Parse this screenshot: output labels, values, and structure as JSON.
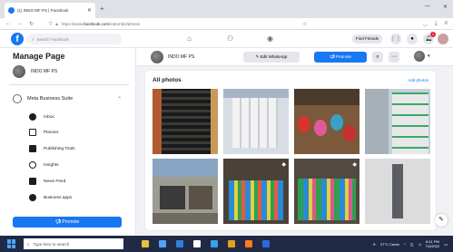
{
  "browser": {
    "tab_title": "(1) INDO MF PS | Facebook",
    "url_prefix": "https://www.",
    "url_domain": "facebook.com",
    "url_path": "/indomfps/photos"
  },
  "header": {
    "search_placeholder": "Search Facebook",
    "find_friends": "Find Friends",
    "notification_count": "1"
  },
  "sidebar": {
    "title": "Manage Page",
    "page_name": "INDO MF PS",
    "suite_label": "Meta Business Suite",
    "items": [
      {
        "label": "Inbox"
      },
      {
        "label": "Planner"
      },
      {
        "label": "Publishing Tools"
      },
      {
        "label": "Insights"
      },
      {
        "label": "News Feed"
      },
      {
        "label": "Business apps"
      }
    ],
    "promote_label": "Promote"
  },
  "pagebar": {
    "page_name": "INDO MF PS",
    "edit_whatsapp": "Edit WhatsApp",
    "promote": "Promote"
  },
  "photos": {
    "title": "All photos",
    "add_label": "Add photos"
  },
  "taskbar": {
    "search_placeholder": "Type here to search",
    "weather": "27°C Cerah",
    "time": "8:41 PM",
    "date": "7/4/2022"
  }
}
